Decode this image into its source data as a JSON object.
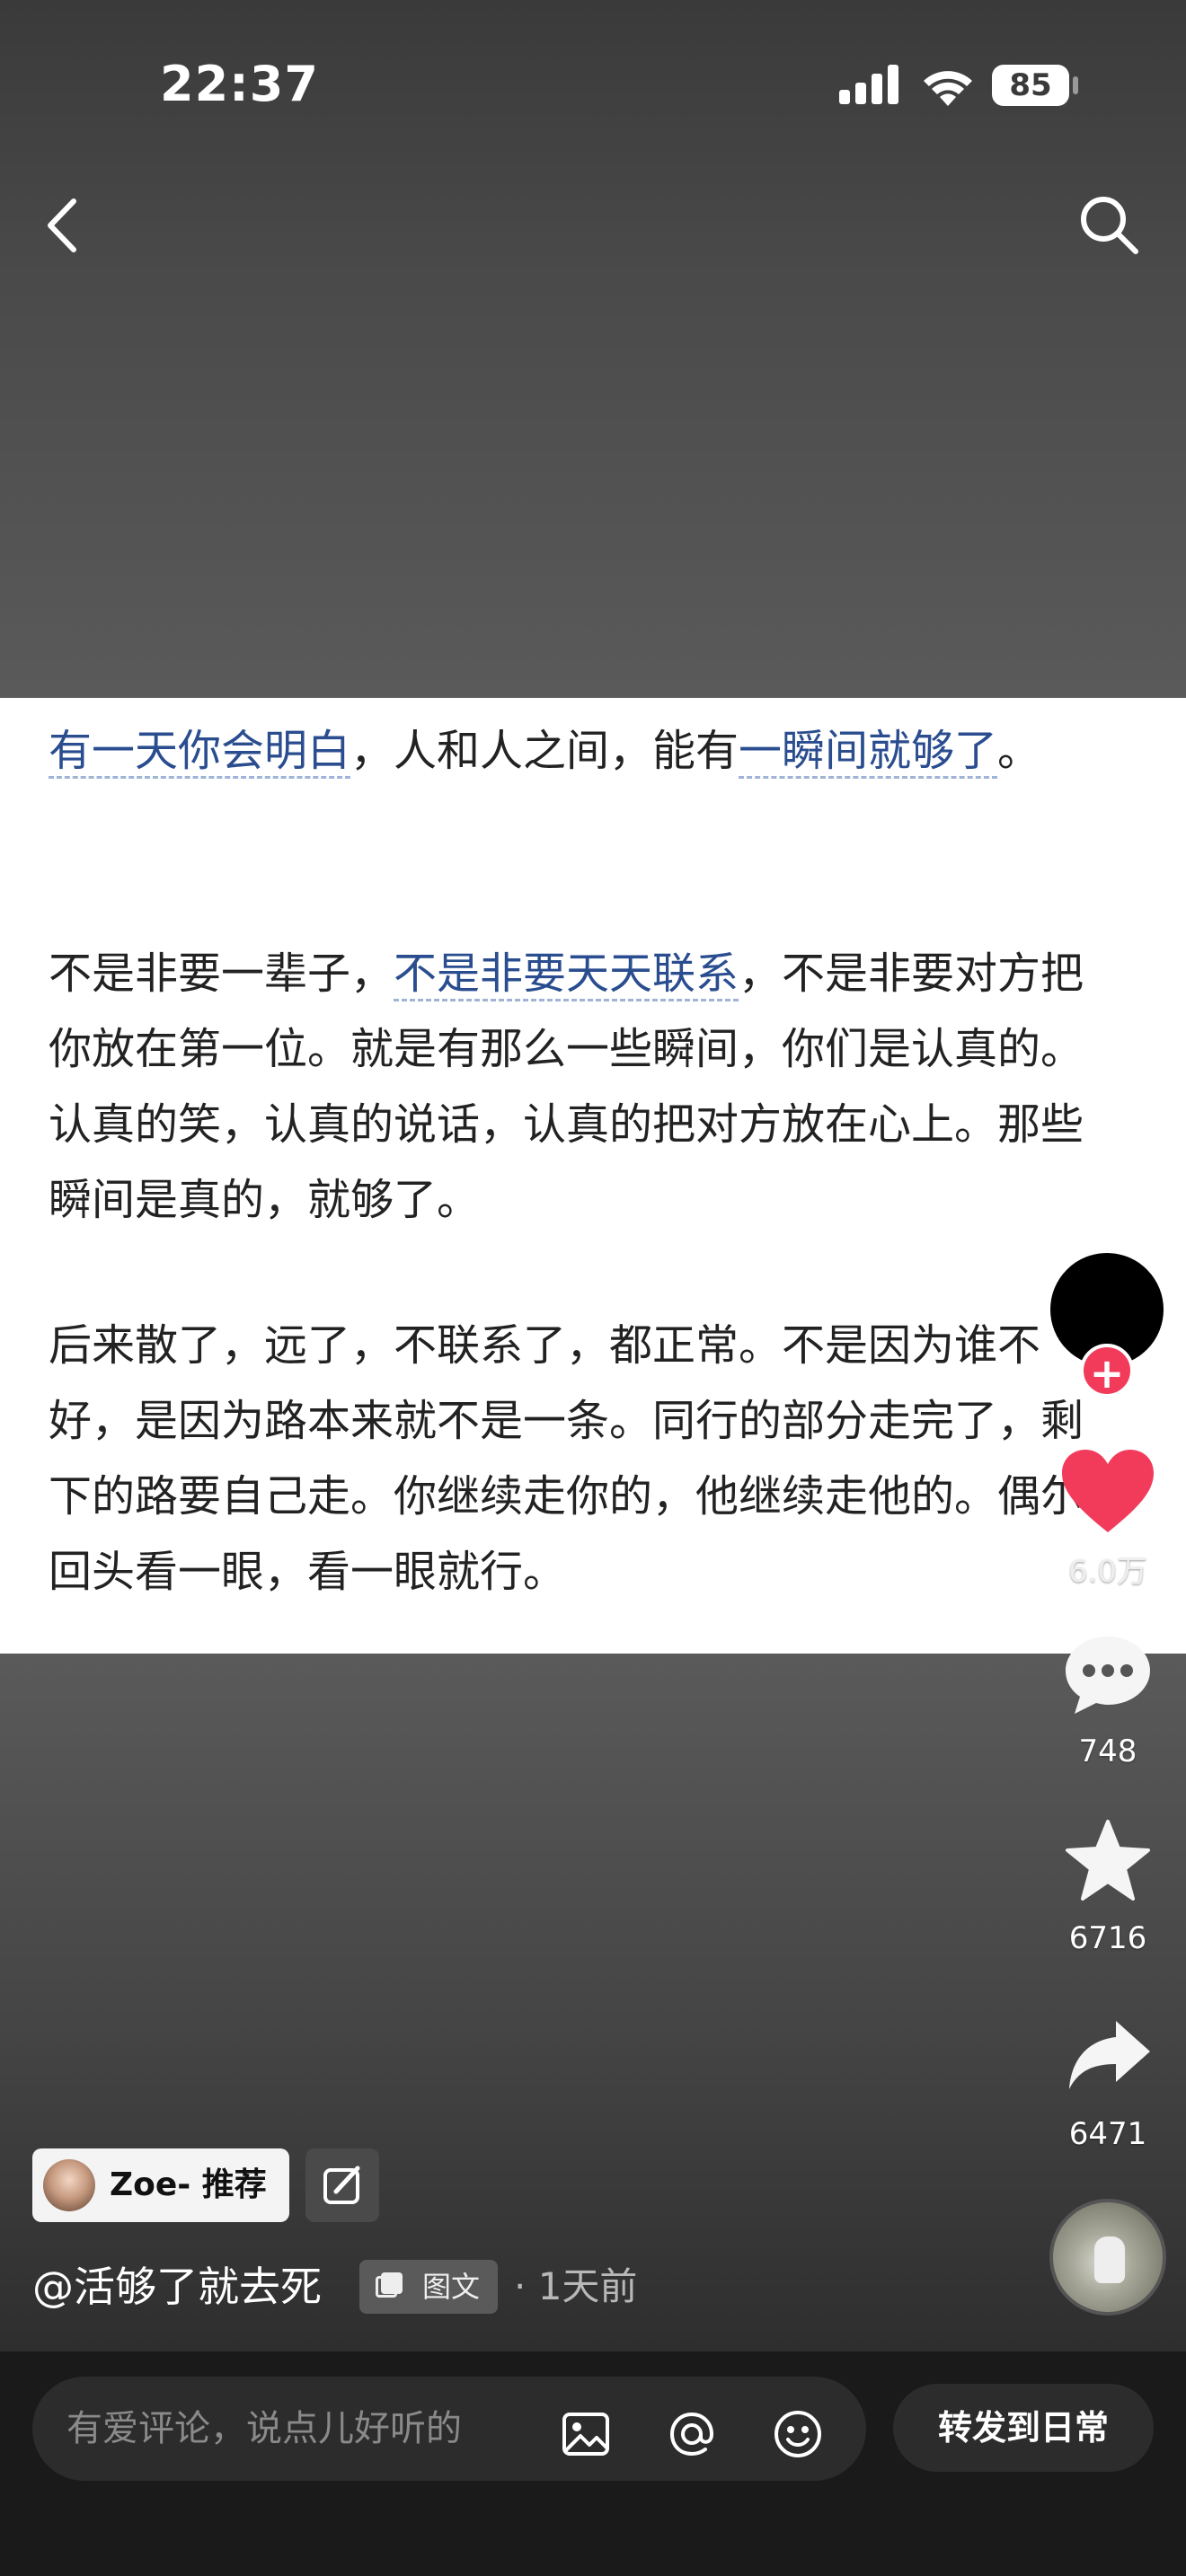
{
  "status_bar": {
    "time": "22:37",
    "battery": "85"
  },
  "post": {
    "paragraphs": [
      [
        {
          "text": "有一天你会明白",
          "link": true
        },
        {
          "text": "，人和人之间，能有",
          "link": false
        },
        {
          "text": "一瞬间就够了",
          "link": true
        },
        {
          "text": "。",
          "link": false
        }
      ],
      [
        {
          "text": "不是非要一辈子，",
          "link": false
        },
        {
          "text": "不是非要天天联系",
          "link": true
        },
        {
          "text": "，不是非要对方把你放在第一位。就是有那么一些瞬间，你们是认真的。认真的笑，认真的说话，认真的把对方放在心上。那些瞬间是真的，就够了。",
          "link": false
        }
      ],
      [
        {
          "text": "后来散了，远了，不联系了，都正常。不是因为谁不好，是因为路本来就不是一条。同行的部分走完了，剩下的路要自己走。你继续走你的，他继续走他的。偶尔回头看一眼，看一眼就行。",
          "link": false
        }
      ]
    ]
  },
  "rail": {
    "likes": "6.0万",
    "comments": "748",
    "favorites": "6716",
    "shares": "6471"
  },
  "meta": {
    "recommender": "Zoe- 推荐",
    "author": "@活够了就去死",
    "tag": "图文",
    "time": "· 1天前"
  },
  "bottom": {
    "comment_placeholder": "有爱评论，说点儿好听的",
    "forward_label": "转发到日常"
  },
  "colors": {
    "link": "#2a4d8f",
    "like": "#f23b5a",
    "background": "#3c3c3c"
  },
  "icons": [
    "back-icon",
    "search-icon",
    "heart-icon",
    "comment-icon",
    "star-icon",
    "share-icon",
    "image-icon",
    "at-icon",
    "emoji-icon",
    "edit-icon",
    "plus-icon"
  ]
}
